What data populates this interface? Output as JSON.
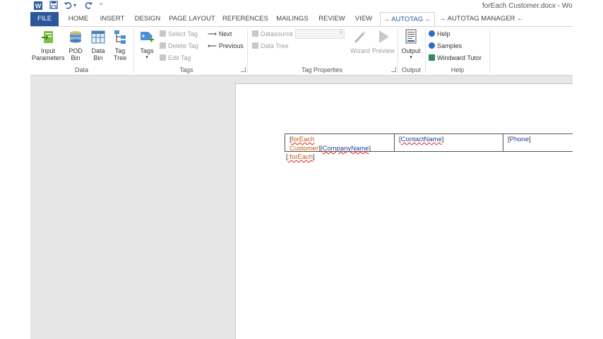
{
  "window": {
    "title": "forEach Customer.docx - Word"
  },
  "quick_access": {
    "app_icon": "word-icon",
    "save": "save-icon",
    "undo": "undo-icon",
    "undo_dropdown": "▾",
    "redo": "redo-icon",
    "customize": "⁼"
  },
  "tabs": [
    "FILE",
    "HOME",
    "INSERT",
    "DESIGN",
    "PAGE LAYOUT",
    "REFERENCES",
    "MAILINGS",
    "REVIEW",
    "VIEW",
    "→ AUTOTAG ←",
    "→ AUTOTAG MANAGER ←"
  ],
  "ribbon": {
    "data_group": {
      "label": "Data",
      "buttons": [
        {
          "label1": "Input",
          "label2": "Parameters",
          "icon": "input-parameters-icon"
        },
        {
          "label1": "POD",
          "label2": "Bin",
          "icon": "pod-bin-icon"
        },
        {
          "label1": "Data",
          "label2": "Bin",
          "icon": "data-bin-icon"
        },
        {
          "label1": "Tag",
          "label2": "Tree",
          "icon": "tag-tree-icon"
        }
      ]
    },
    "tags_group": {
      "label": "Tags",
      "tags_button": "Tags",
      "tags_arrow": "▾",
      "select_tag": "Select Tag",
      "delete_tag": "Delete Tag",
      "edit_tag": "Edit Tag",
      "next": "Next",
      "previous": "Previous"
    },
    "tag_properties_group": {
      "label": "Tag Properties",
      "datasource": "Datasource",
      "datasource_value": "",
      "data_tree": "Data Tree",
      "wizard": "Wizard",
      "preview": "Preview"
    },
    "output_group": {
      "label": "Output",
      "output_button": "Output",
      "output_arrow": "▾"
    },
    "help_group": {
      "label": "Help",
      "help": "Help",
      "samples": "Samples",
      "windward_tutor": "Windward Tutor"
    }
  },
  "document": {
    "cell1_line1_open": "[",
    "cell1_line1_tag": "forEach",
    "cell1_line2_tag": "Customer",
    "cell1_line2_mid": "][",
    "cell1_line2_field": "CompanyName",
    "cell1_line2_close": "]",
    "cell2_open": "[",
    "cell2_field": "ContactName",
    "cell2_close": "]",
    "cell3_open": "[",
    "cell3_field": "Phone",
    "cell3_close": "]",
    "end_open": "[",
    "end_tag": ":forEach",
    "end_close": "]"
  }
}
